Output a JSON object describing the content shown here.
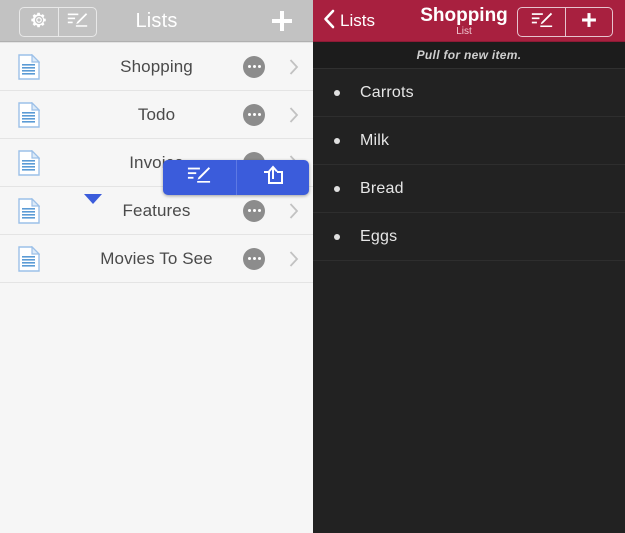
{
  "left": {
    "nav": {
      "title": "Lists",
      "settings_icon": "gear-icon",
      "compose_icon": "compose-list-icon",
      "add_icon": "plus-icon",
      "background_color": "#c2c2c2"
    },
    "rows": [
      {
        "label": "Shopping",
        "icon": "document-icon",
        "more_icon": "ellipsis-icon",
        "chevron_icon": "chevron-right-icon"
      },
      {
        "label": "Todo",
        "icon": "document-icon",
        "more_icon": "ellipsis-icon",
        "chevron_icon": "chevron-right-icon"
      },
      {
        "label": "Invoice",
        "icon": "document-icon",
        "more_icon": "ellipsis-icon",
        "chevron_icon": "chevron-right-icon"
      },
      {
        "label": "Features",
        "icon": "document-icon",
        "more_icon": "ellipsis-icon",
        "chevron_icon": "chevron-right-icon"
      },
      {
        "label": "Movies To See",
        "icon": "document-icon",
        "more_icon": "ellipsis-icon",
        "chevron_icon": "chevron-right-icon"
      }
    ],
    "popup": {
      "edit_icon": "edit-list-icon",
      "share_icon": "share-icon",
      "color": "#3b5cdb"
    }
  },
  "right": {
    "nav": {
      "back_label": "Lists",
      "back_icon": "chevron-left-icon",
      "title": "Shopping",
      "subtitle": "List",
      "compose_icon": "compose-list-icon",
      "add_icon": "plus-icon",
      "background_color": "#a8203f"
    },
    "pull_hint": "Pull for new item.",
    "items": [
      {
        "label": "Carrots",
        "bullet": "bullet-icon"
      },
      {
        "label": "Milk",
        "bullet": "bullet-icon"
      },
      {
        "label": "Bread",
        "bullet": "bullet-icon"
      },
      {
        "label": "Eggs",
        "bullet": "bullet-icon"
      }
    ],
    "background_color": "#222222"
  }
}
